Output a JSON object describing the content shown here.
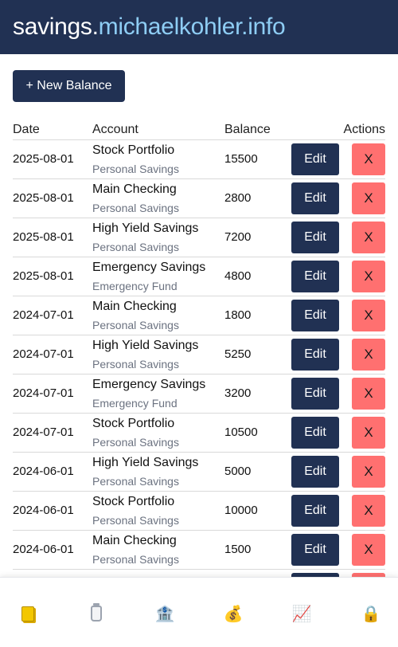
{
  "header": {
    "title_part1": "savings.",
    "title_part2": "michaelkohler.info"
  },
  "toolbar": {
    "new_balance_label": "+ New Balance"
  },
  "table": {
    "headers": {
      "date": "Date",
      "account": "Account",
      "balance": "Balance",
      "actions": "Actions"
    },
    "edit_label": "Edit",
    "delete_label": "X",
    "rows": [
      {
        "date": "2025-08-01",
        "account": "Stock Portfolio",
        "type": "Personal Savings",
        "balance": "15500"
      },
      {
        "date": "2025-08-01",
        "account": "Main Checking",
        "type": "Personal Savings",
        "balance": "2800"
      },
      {
        "date": "2025-08-01",
        "account": "High Yield Savings",
        "type": "Personal Savings",
        "balance": "7200"
      },
      {
        "date": "2025-08-01",
        "account": "Emergency Savings",
        "type": "Emergency Fund",
        "balance": "4800"
      },
      {
        "date": "2024-07-01",
        "account": "Main Checking",
        "type": "Personal Savings",
        "balance": "1800"
      },
      {
        "date": "2024-07-01",
        "account": "High Yield Savings",
        "type": "Personal Savings",
        "balance": "5250"
      },
      {
        "date": "2024-07-01",
        "account": "Emergency Savings",
        "type": "Emergency Fund",
        "balance": "3200"
      },
      {
        "date": "2024-07-01",
        "account": "Stock Portfolio",
        "type": "Personal Savings",
        "balance": "10500"
      },
      {
        "date": "2024-06-01",
        "account": "High Yield Savings",
        "type": "Personal Savings",
        "balance": "5000"
      },
      {
        "date": "2024-06-01",
        "account": "Stock Portfolio",
        "type": "Personal Savings",
        "balance": "10000"
      },
      {
        "date": "2024-06-01",
        "account": "Main Checking",
        "type": "Personal Savings",
        "balance": "1500"
      },
      {
        "date": "",
        "account": "",
        "type": "",
        "balance": ""
      }
    ]
  },
  "bottom_nav": {
    "items": [
      {
        "icon": "ledger-icon",
        "glyph": ""
      },
      {
        "icon": "jar-icon",
        "glyph": ""
      },
      {
        "icon": "bank-icon",
        "glyph": "🏦"
      },
      {
        "icon": "money-bag-icon",
        "glyph": "💰"
      },
      {
        "icon": "chart-increasing-icon",
        "glyph": "📈"
      },
      {
        "icon": "lock-icon",
        "glyph": "🔒"
      }
    ]
  },
  "colors": {
    "brand_navy": "#213153",
    "brand_light_blue": "#8ecdf4",
    "delete_red": "#ff7070",
    "muted_text": "#6b7280"
  }
}
